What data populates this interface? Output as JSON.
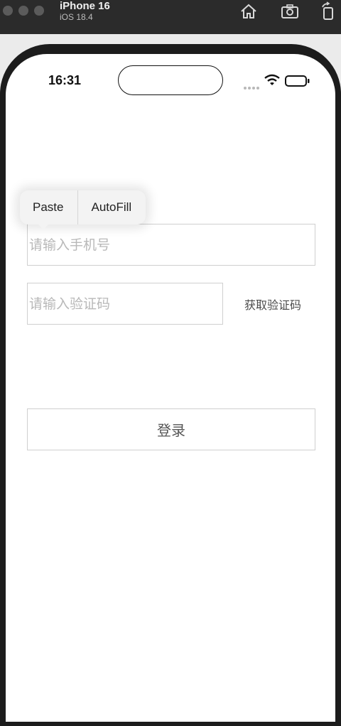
{
  "simulator": {
    "device_name": "iPhone 16",
    "os_version": "iOS 18.4",
    "toolbar": [
      "home-icon",
      "screenshot-icon",
      "rotate-icon"
    ]
  },
  "status_bar": {
    "time": "16:31",
    "icons": [
      "cellular-dots-icon",
      "wifi-icon",
      "battery-icon"
    ]
  },
  "edit_menu": {
    "items": [
      {
        "label": "Paste"
      },
      {
        "label": "AutoFill"
      }
    ]
  },
  "form": {
    "phone_placeholder": "请输入手机号",
    "code_placeholder": "请输入验证码",
    "get_code_label": "获取验证码",
    "login_label": "登录"
  },
  "colors": {
    "simulator_bar": "#2b2b2b",
    "field_border": "#cfcfcf",
    "placeholder": "#b8b8b8"
  }
}
